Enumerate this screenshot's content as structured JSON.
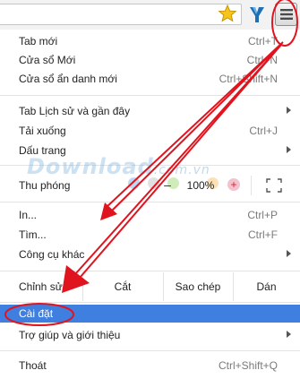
{
  "menu": {
    "new_tab": {
      "label": "Tab mới",
      "shortcut": "Ctrl+T"
    },
    "new_window": {
      "label": "Cửa sổ Mới",
      "shortcut": "Ctrl+N"
    },
    "incognito": {
      "label": "Cửa sổ ẩn danh mới",
      "shortcut": "Ctrl+Shift+N"
    },
    "history": {
      "label": "Tab Lịch sử và gần đây"
    },
    "downloads": {
      "label": "Tải xuống",
      "shortcut": "Ctrl+J"
    },
    "bookmarks": {
      "label": "Dấu trang"
    },
    "zoom": {
      "label": "Thu phóng",
      "minus": "–",
      "value": "100%",
      "plus": "+"
    },
    "print": {
      "label": "In...",
      "shortcut": "Ctrl+P"
    },
    "find": {
      "label": "Tìm...",
      "shortcut": "Ctrl+F"
    },
    "more_tools": {
      "label": "Công cụ khác"
    },
    "edit": {
      "label": "Chỉnh sửa",
      "cut": "Cắt",
      "copy": "Sao chép",
      "paste": "Dán"
    },
    "settings": {
      "label": "Cài đặt"
    },
    "help": {
      "label": "Trợ giúp và giới thiệu"
    },
    "exit": {
      "label": "Thoát",
      "shortcut": "Ctrl+Shift+Q"
    }
  },
  "watermark": {
    "main": "Download",
    "suffix": ".com.vn"
  },
  "colors": {
    "highlight": "#3f7fe0",
    "annotation": "#e0141e",
    "star": "#f5c518"
  }
}
